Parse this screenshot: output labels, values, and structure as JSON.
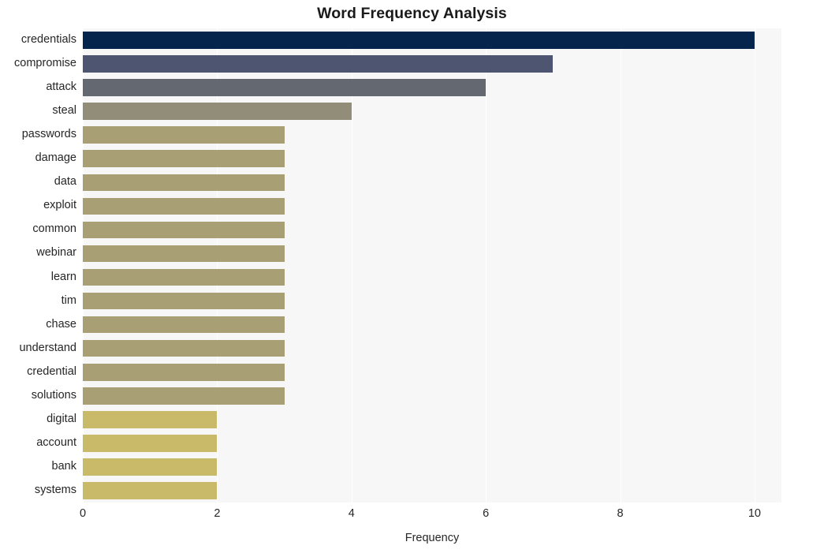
{
  "chart_data": {
    "type": "bar",
    "orientation": "horizontal",
    "title": "Word Frequency Analysis",
    "xlabel": "Frequency",
    "ylabel": "",
    "xlim": [
      0,
      10.4
    ],
    "ylim": [
      0,
      20
    ],
    "xticks": [
      "0",
      "2",
      "4",
      "6",
      "8",
      "10"
    ],
    "xtick_values": [
      0,
      2,
      4,
      6,
      8,
      10
    ],
    "grid": "vertical-white-on-light-gray",
    "legend": "none",
    "categories": [
      "credentials",
      "compromise",
      "attack",
      "steal",
      "passwords",
      "damage",
      "data",
      "exploit",
      "common",
      "webinar",
      "learn",
      "tim",
      "chase",
      "understand",
      "credential",
      "solutions",
      "digital",
      "account",
      "bank",
      "systems"
    ],
    "values": [
      10,
      7,
      6,
      4,
      3,
      3,
      3,
      3,
      3,
      3,
      3,
      3,
      3,
      3,
      3,
      3,
      2,
      2,
      2,
      2
    ],
    "bar_colors": [
      "#06254c",
      "#4d5570",
      "#636871",
      "#918d79",
      "#a89f74",
      "#a89f74",
      "#a89f74",
      "#a89f74",
      "#a89f74",
      "#a89f74",
      "#a89f74",
      "#a89f74",
      "#a89f74",
      "#a89f74",
      "#a89f74",
      "#a89f74",
      "#c8ba68",
      "#c8ba68",
      "#c8ba68",
      "#c8ba68"
    ]
  },
  "style": {
    "figure_background": "#ffffff",
    "plot_background": "#f7f7f7",
    "gridline_color": "#ffffff",
    "text_color": "#262626",
    "title_color": "#1a1a1a"
  }
}
